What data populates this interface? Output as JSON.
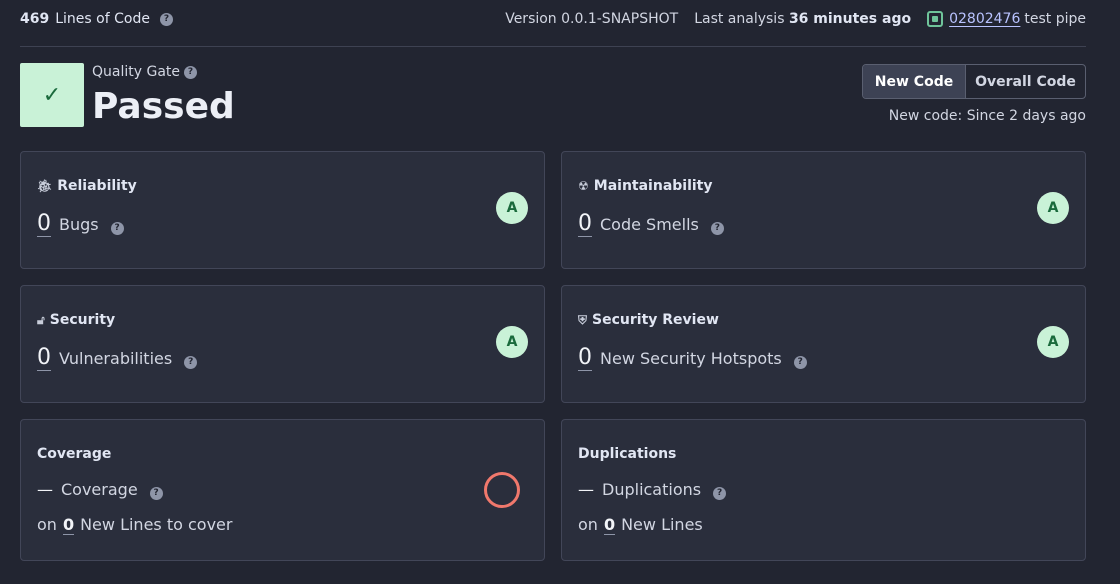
{
  "header": {
    "loc_count": "469",
    "loc_label": "Lines of Code",
    "version": "Version 0.0.1-SNAPSHOT",
    "last_analysis_label": "Last analysis",
    "last_analysis_value": "36 minutes ago",
    "pipeline_id": "02802476",
    "pipeline_label": "test pipe"
  },
  "quality_gate": {
    "label": "Quality Gate",
    "status": "Passed",
    "check": "✓"
  },
  "toggle": {
    "new_code": "New Code",
    "overall_code": "Overall Code",
    "since": "New code: Since 2 days ago"
  },
  "cards": {
    "reliability": {
      "title": "Reliability",
      "value": "0",
      "metric": "Bugs",
      "rating": "A"
    },
    "maintainability": {
      "title": "Maintainability",
      "value": "0",
      "metric": "Code Smells",
      "rating": "A"
    },
    "security": {
      "title": "Security",
      "value": "0",
      "metric": "Vulnerabilities",
      "rating": "A"
    },
    "security_review": {
      "title": "Security Review",
      "value": "0",
      "metric": "New Security Hotspots",
      "rating": "A"
    },
    "coverage": {
      "title": "Coverage",
      "value": "—",
      "metric": "Coverage",
      "sub_prefix": "on",
      "sub_value": "0",
      "sub_text": "New Lines to cover"
    },
    "duplications": {
      "title": "Duplications",
      "value": "—",
      "metric": "Duplications",
      "sub_prefix": "on",
      "sub_value": "0",
      "sub_text": "New Lines"
    }
  },
  "colors": {
    "background": "#222531",
    "card": "#2a2e3c",
    "rating_a": "#c9f2d7",
    "coverage_ring": "#f0786c"
  },
  "icons": {
    "help": "?",
    "reliability": "bug-icon",
    "maintainability": "smell-icon",
    "security": "lock-icon",
    "security_review": "shield-icon",
    "pipeline": "pipeline-icon"
  }
}
